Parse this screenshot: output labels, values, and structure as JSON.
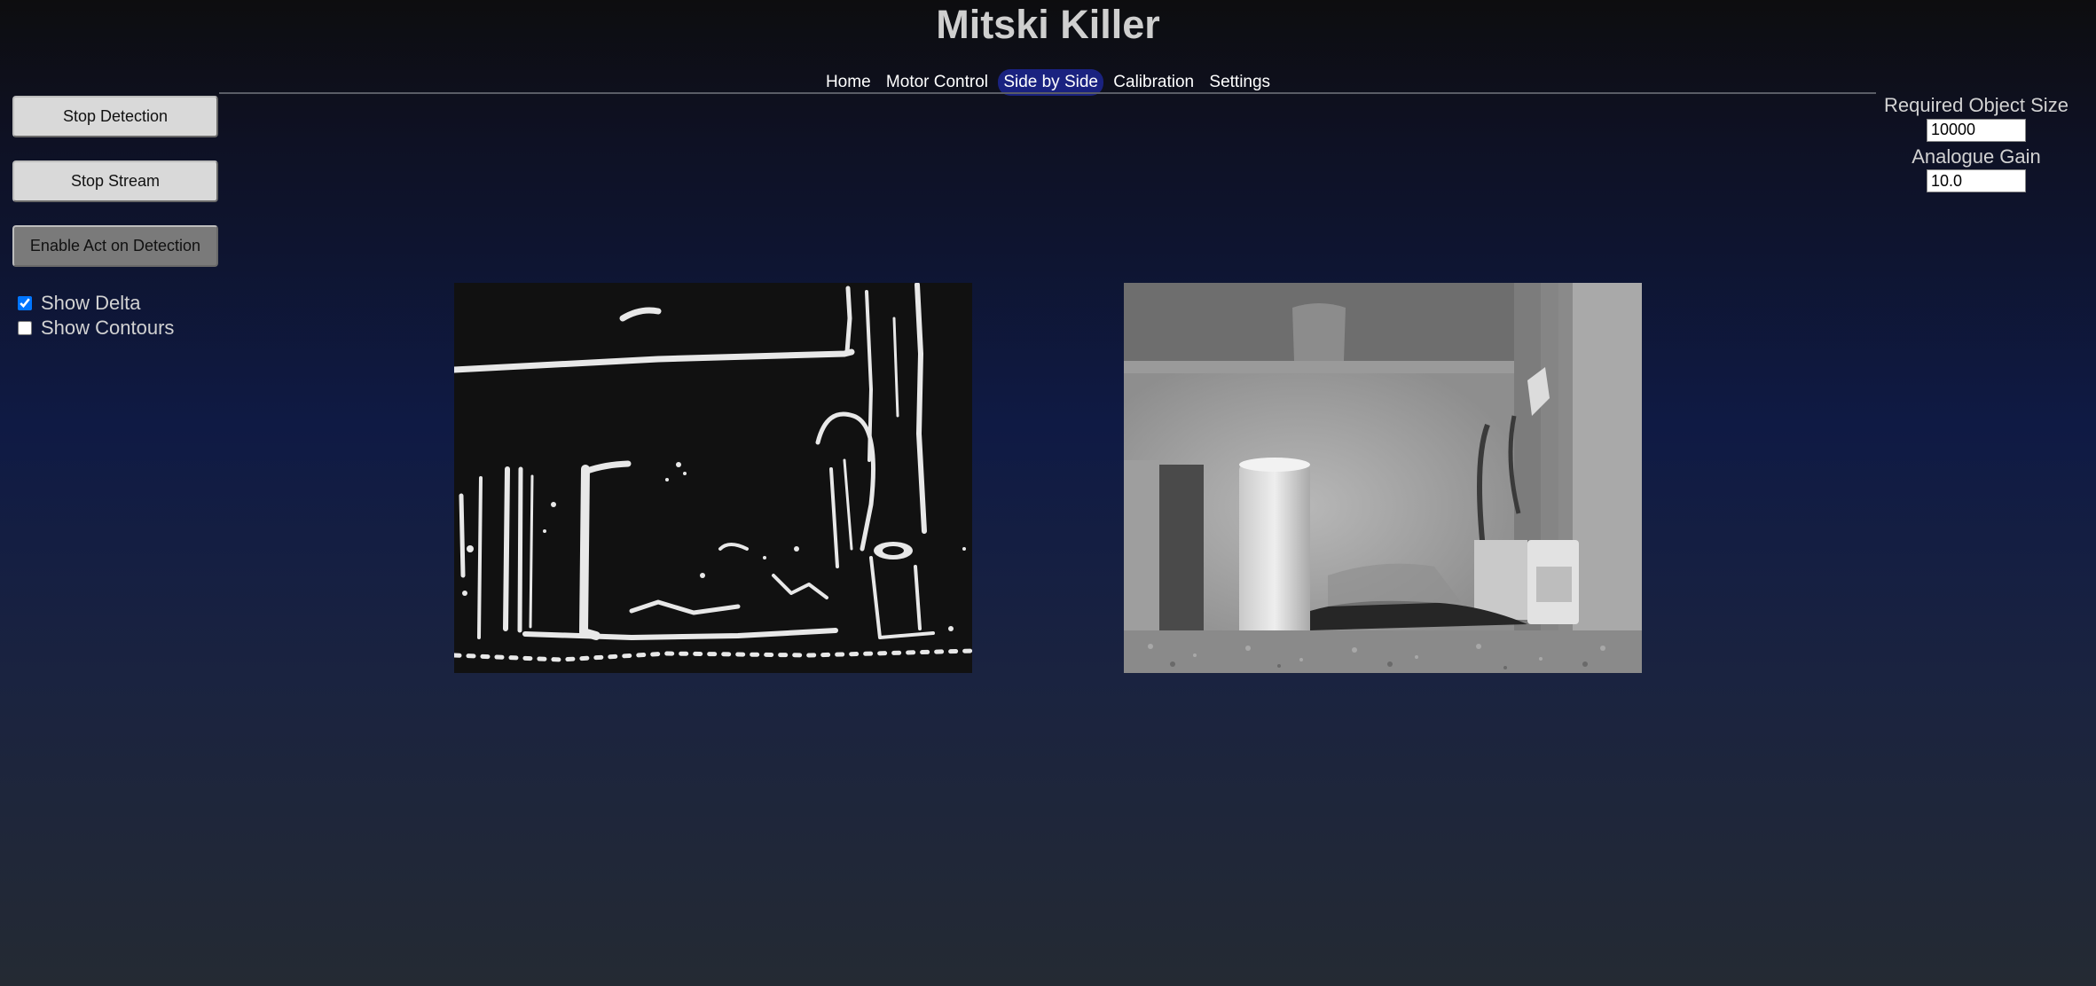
{
  "app": {
    "title": "Mitski Killer"
  },
  "nav": {
    "items": [
      {
        "label": "Home",
        "active": false
      },
      {
        "label": "Motor Control",
        "active": false
      },
      {
        "label": "Side by Side",
        "active": true
      },
      {
        "label": "Calibration",
        "active": false
      },
      {
        "label": "Settings",
        "active": false
      }
    ]
  },
  "controls": {
    "stop_detection_label": "Stop Detection",
    "stop_stream_label": "Stop Stream",
    "enable_act_label": "Enable Act on Detection",
    "show_delta": {
      "label": "Show Delta",
      "checked": true
    },
    "show_contours": {
      "label": "Show Contours",
      "checked": false
    }
  },
  "settings": {
    "required_object_size": {
      "label": "Required Object Size",
      "value": "10000"
    },
    "analogue_gain": {
      "label": "Analogue Gain",
      "value": "10.0"
    }
  },
  "colors": {
    "active_nav": "#1a2280",
    "button_bg": "#d9d9d9",
    "act_button_bg": "#7a7a7a"
  },
  "feeds": {
    "delta": {
      "icon": "delta-mask-image"
    },
    "camera": {
      "icon": "camera-feed-image"
    }
  }
}
